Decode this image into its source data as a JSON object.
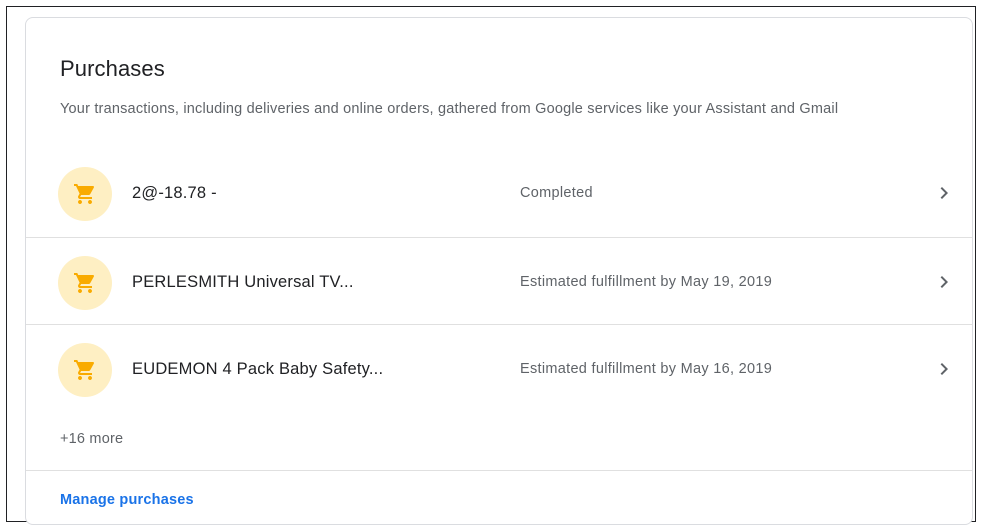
{
  "card": {
    "title": "Purchases",
    "subtitle": "Your transactions, including deliveries and online orders, gathered from Google services like your Assistant and Gmail"
  },
  "purchases": [
    {
      "name": "2@-18.78 -",
      "status": "Completed",
      "icon": "shopping-cart-icon"
    },
    {
      "name": "PERLESMITH Universal TV...",
      "status": "Estimated fulfillment by May 19, 2019",
      "icon": "shopping-cart-icon"
    },
    {
      "name": "EUDEMON 4 Pack Baby Safety...",
      "status": "Estimated fulfillment by May 16, 2019",
      "icon": "shopping-cart-icon"
    }
  ],
  "more_label": "+16 more",
  "manage_label": "Manage purchases",
  "colors": {
    "icon_bg": "#feefc3",
    "icon_fg": "#f9ab00",
    "link": "#1a73e8"
  }
}
